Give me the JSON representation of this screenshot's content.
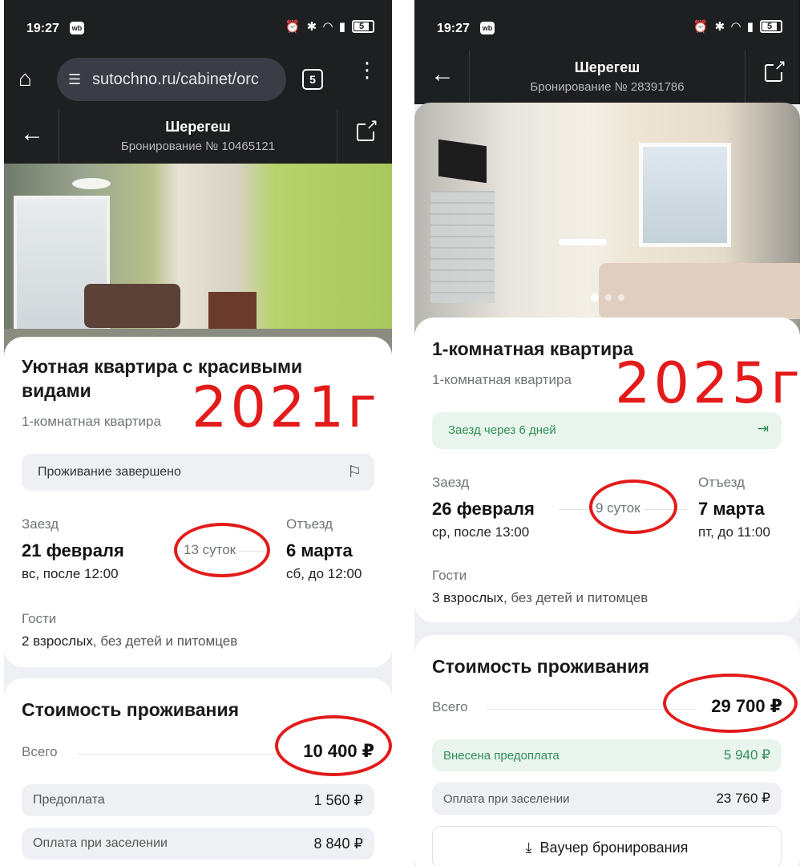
{
  "left": {
    "status": {
      "time": "19:27",
      "app_badge": "wb",
      "battery": "5"
    },
    "browser": {
      "url": "sutochno.ru/cabinet/orc",
      "tabs_count": "5"
    },
    "header": {
      "title": "Шерегеш",
      "subtitle": "Бронирование № 10465121"
    },
    "listing": {
      "title": "Уютная квартира с красивыми видами",
      "type": "1-комнатная квартира"
    },
    "status_pill": "Проживание завершено",
    "checkin": {
      "label": "Заезд",
      "date": "21 февраля",
      "time": "вс, после 12:00"
    },
    "nights": "13 суток",
    "checkout": {
      "label": "Отъезд",
      "date": "6 марта",
      "time": "сб, до 12:00"
    },
    "guests": {
      "label": "Гости",
      "adults": "2 взрослых",
      "rest": ", без детей и питомцев"
    },
    "cost": {
      "title": "Стоимость проживания",
      "total_label": "Всего",
      "total_value": "10 400 ₽",
      "prepay_label": "Предоплата",
      "prepay_value": "1 560 ₽",
      "on_arrival_label": "Оплата при заселении",
      "on_arrival_value": "8 840 ₽"
    },
    "annotation_year": "2021г"
  },
  "right": {
    "status": {
      "time": "19:27",
      "app_badge": "wb",
      "battery": "5"
    },
    "header": {
      "title": "Шерегеш",
      "subtitle": "Бронирование № 28391786"
    },
    "listing": {
      "title": "1-комнатная квартира",
      "type": "1-комнатная квартира"
    },
    "checkin_notice": "Заезд через 6 дней",
    "checkin": {
      "label": "Заезд",
      "date": "26 февраля",
      "time": "ср, после 13:00"
    },
    "nights": "9 суток",
    "checkout": {
      "label": "Отъезд",
      "date": "7 марта",
      "time": "пт, до 11:00"
    },
    "guests": {
      "label": "Гости",
      "adults": "3 взрослых",
      "rest": ", без детей и питомцев"
    },
    "cost": {
      "title": "Стоимость проживания",
      "total_label": "Всего",
      "total_value": "29 700 ₽",
      "prepay_label": "Внесена предоплата",
      "prepay_value": "5 940 ₽",
      "on_arrival_label": "Оплата при заселении",
      "on_arrival_value": "23 760 ₽"
    },
    "voucher_button": "Вaучер бронирования",
    "annotation_year": "2025г"
  },
  "colors": {
    "accent_green": "#2f8f58",
    "annotation_red": "#e31b1b",
    "dark_bar": "#1e1f21"
  },
  "icons": [
    "home-icon",
    "tune-icon",
    "tabs-icon",
    "more-vert-icon",
    "back-arrow-icon",
    "external-link-icon",
    "flag-icon",
    "exit-icon",
    "download-icon",
    "alarm-icon",
    "bluetooth-icon",
    "wifi-icon",
    "signal-icon",
    "battery-icon"
  ]
}
